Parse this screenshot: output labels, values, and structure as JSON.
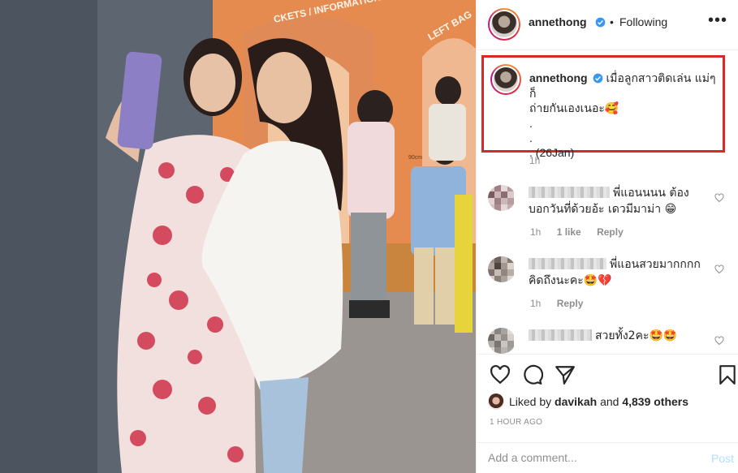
{
  "post": {
    "author": "annethong",
    "follow_status": "Following",
    "more_icon": "ellipsis-icon"
  },
  "photo": {
    "sign_text_1": "CKETS / INFORMATION",
    "sign_text_2": "LEFT BAG",
    "height_mark": "90cm"
  },
  "caption": {
    "author": "annethong",
    "line1": "เมื่อลูกสาวติดเล่น แม่ๆก็",
    "line2": "ถ่ายกันเองเนอะ🥰",
    "dot1": ".",
    "dot2": ".",
    "line5": ". (26Jan)",
    "time": "1h"
  },
  "comments": [
    {
      "text": "พี่แอนนนน ต้อง",
      "text2": "บอกวันที่ด้วยอ้ะ เดวมีมาม่า 😁",
      "time": "1h",
      "likes": "1 like",
      "reply": "Reply"
    },
    {
      "text": "พี่แอนสวยมากกกก",
      "text2": "คิดถึงนะคะ🤩💔",
      "time": "1h",
      "reply": "Reply"
    },
    {
      "text": "สวยทั้ง2คะ🤩🤩"
    }
  ],
  "likes": {
    "prefix": "Liked by",
    "user": "davikah",
    "and": "and",
    "count": "4,839 others"
  },
  "timestamp": "1 HOUR AGO",
  "add_comment": {
    "placeholder": "Add a comment...",
    "post_label": "Post"
  },
  "colors": {
    "highlight_box": "#d42a2a",
    "verified": "#3897f0",
    "post_button": "#b2dffc"
  }
}
